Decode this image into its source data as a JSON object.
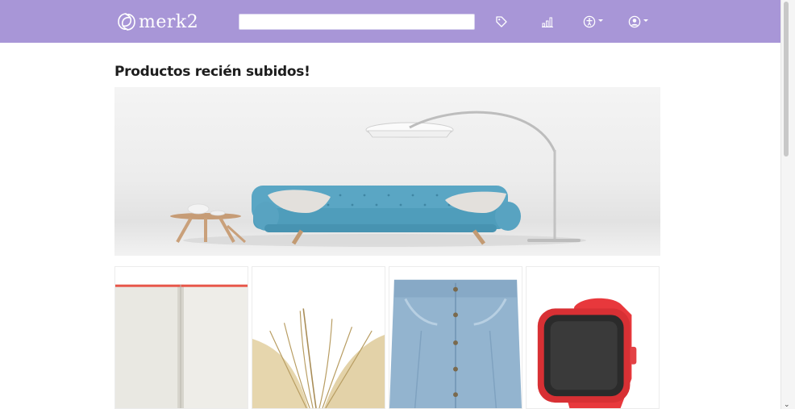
{
  "header": {
    "brand": "merk2",
    "search": {
      "value": "",
      "placeholder": ""
    },
    "icons": [
      "tag-icon",
      "stats-icon",
      "accessibility-icon",
      "user-icon"
    ]
  },
  "main": {
    "section_title": "Productos recién subidos!",
    "hero": {
      "image": "living-room-sofa-with-floor-lamp"
    },
    "products": [
      {
        "image": "blank-notebook"
      },
      {
        "image": "open-book"
      },
      {
        "image": "denim-skirt"
      },
      {
        "image": "red-smartwatch"
      }
    ]
  },
  "colors": {
    "navbar": "#a896d7",
    "sofa": "#5aa6c4",
    "watch": "#e8383c"
  }
}
